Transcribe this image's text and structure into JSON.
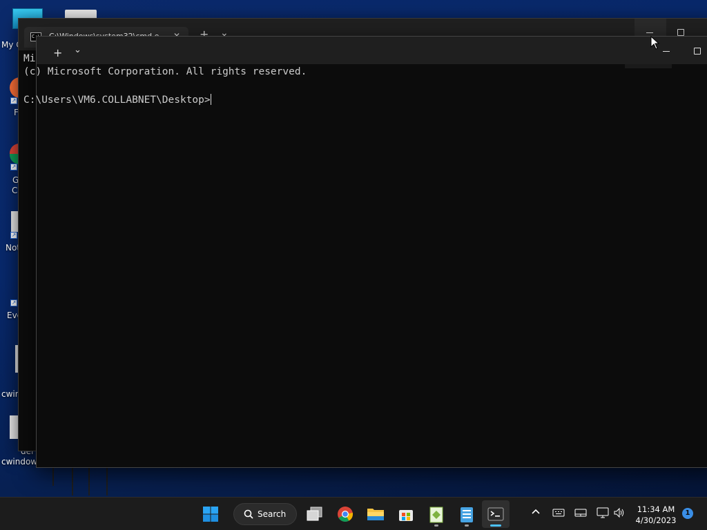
{
  "desktop": {
    "icons": [
      {
        "label": "My C"
      },
      {
        "label": "F"
      },
      {
        "label": "G"
      },
      {
        "label": "C"
      },
      {
        "label": "Not"
      },
      {
        "label": "Eve"
      },
      {
        "label": "cwin"
      },
      {
        "label": "del"
      },
      {
        "label": "cwindow"
      }
    ]
  },
  "back_window": {
    "tab_title": "C:\\Windows\\system32\\cmd.e",
    "new_tab": "+",
    "dropdown": "⌄"
  },
  "front_window": {
    "new_tab": "+",
    "dropdown": "⌄",
    "lines": [
      "Mi",
      "(c) Microsoft Corporation. All rights reserved.",
      "",
      "C:\\Users\\VM6.COLLABNET\\Desktop>"
    ]
  },
  "taskbar": {
    "search_label": "Search",
    "clock_time": "11:34 AM",
    "clock_date": "4/30/2023",
    "notification_count": "1",
    "accent": "#4cc2ff"
  }
}
